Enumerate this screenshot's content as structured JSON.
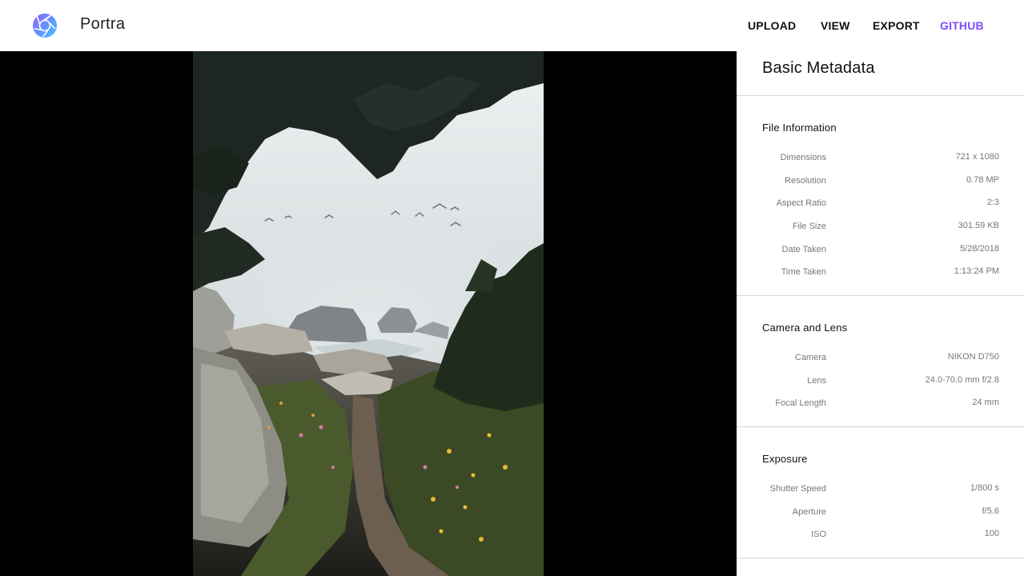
{
  "header": {
    "app_title": "Portra",
    "logo_icon": "aperture-icon",
    "nav": {
      "upload": "UPLOAD",
      "view": "VIEW",
      "export": "EXPORT",
      "github": "GITHUB"
    },
    "colors": {
      "accent": "#7c4dff",
      "logo_gradient_start": "#7c4dff",
      "logo_gradient_end": "#40c4ff"
    }
  },
  "panel": {
    "title": "Basic Metadata",
    "sections": [
      {
        "title": "File Information",
        "rows": [
          {
            "label": "Dimensions",
            "value": "721 x 1080"
          },
          {
            "label": "Resolution",
            "value": "0.78 MP"
          },
          {
            "label": "Aspect Ratio",
            "value": "2:3"
          },
          {
            "label": "File Size",
            "value": "301.59 KB"
          },
          {
            "label": "Date Taken",
            "value": "5/28/2018"
          },
          {
            "label": "Time Taken",
            "value": "1:13:24 PM"
          }
        ]
      },
      {
        "title": "Camera and Lens",
        "rows": [
          {
            "label": "Camera",
            "value": "NIKON D750"
          },
          {
            "label": "Lens",
            "value": "24.0-70.0 mm f/2.8"
          },
          {
            "label": "Focal Length",
            "value": "24 mm"
          }
        ]
      },
      {
        "title": "Exposure",
        "rows": [
          {
            "label": "Shutter Speed",
            "value": "1/800 s"
          },
          {
            "label": "Aperture",
            "value": "f/5.6"
          },
          {
            "label": "ISO",
            "value": "100"
          }
        ]
      }
    ]
  }
}
